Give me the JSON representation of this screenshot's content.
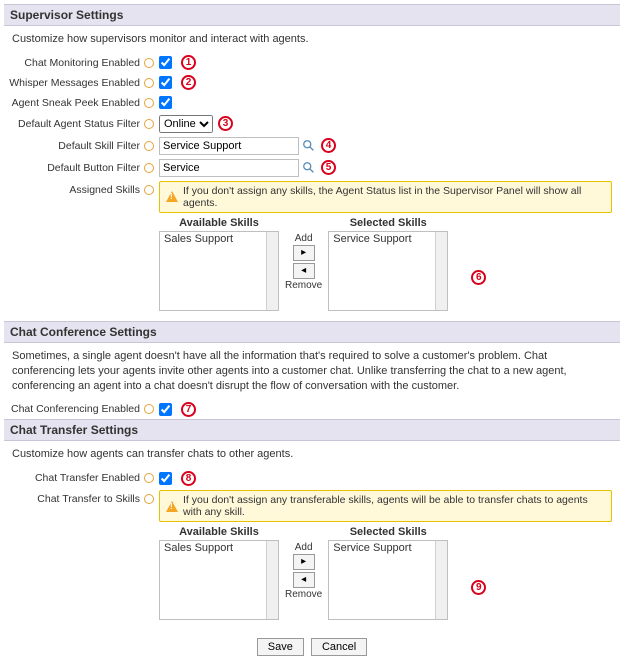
{
  "supervisor": {
    "header": "Supervisor Settings",
    "desc": "Customize how supervisors monitor and interact with agents.",
    "chatMonitoring": {
      "label": "Chat Monitoring Enabled",
      "checked": true
    },
    "whisper": {
      "label": "Whisper Messages Enabled",
      "checked": true
    },
    "sneakPeek": {
      "label": "Agent Sneak Peek Enabled",
      "checked": true
    },
    "statusFilter": {
      "label": "Default Agent Status Filter",
      "value": "Online"
    },
    "skillFilter": {
      "label": "Default Skill Filter",
      "value": "Service Support"
    },
    "buttonFilter": {
      "label": "Default Button Filter",
      "value": "Service"
    },
    "assignedSkills": {
      "label": "Assigned Skills",
      "warning": "If you don't assign any skills, the Agent Status list in the Supervisor Panel will show all agents.",
      "availableTitle": "Available Skills",
      "selectedTitle": "Selected Skills",
      "addLabel": "Add",
      "removeLabel": "Remove",
      "available": [
        "Sales Support"
      ],
      "selected": [
        "Service Support"
      ]
    }
  },
  "conference": {
    "header": "Chat Conference Settings",
    "desc": "Sometimes, a single agent doesn't have all the information that's required to solve a customer's problem. Chat conferencing lets your agents invite other agents into a customer chat. Unlike transferring the chat to a new agent, conferencing an agent into a chat doesn't disrupt the flow of conversation with the customer.",
    "enabled": {
      "label": "Chat Conferencing Enabled",
      "checked": true
    }
  },
  "transfer": {
    "header": "Chat Transfer Settings",
    "desc": "Customize how agents can transfer chats to other agents.",
    "enabled": {
      "label": "Chat Transfer Enabled",
      "checked": true
    },
    "toSkills": {
      "label": "Chat Transfer to Skills",
      "warning": "If you don't assign any transferable skills, agents will be able to transfer chats to agents with any skill.",
      "availableTitle": "Available Skills",
      "selectedTitle": "Selected Skills",
      "addLabel": "Add",
      "removeLabel": "Remove",
      "available": [
        "Sales Support"
      ],
      "selected": [
        "Service Support"
      ]
    }
  },
  "footer": {
    "save": "Save",
    "cancel": "Cancel"
  },
  "annotations": [
    "1",
    "2",
    "3",
    "4",
    "5",
    "6",
    "7",
    "8",
    "9"
  ]
}
